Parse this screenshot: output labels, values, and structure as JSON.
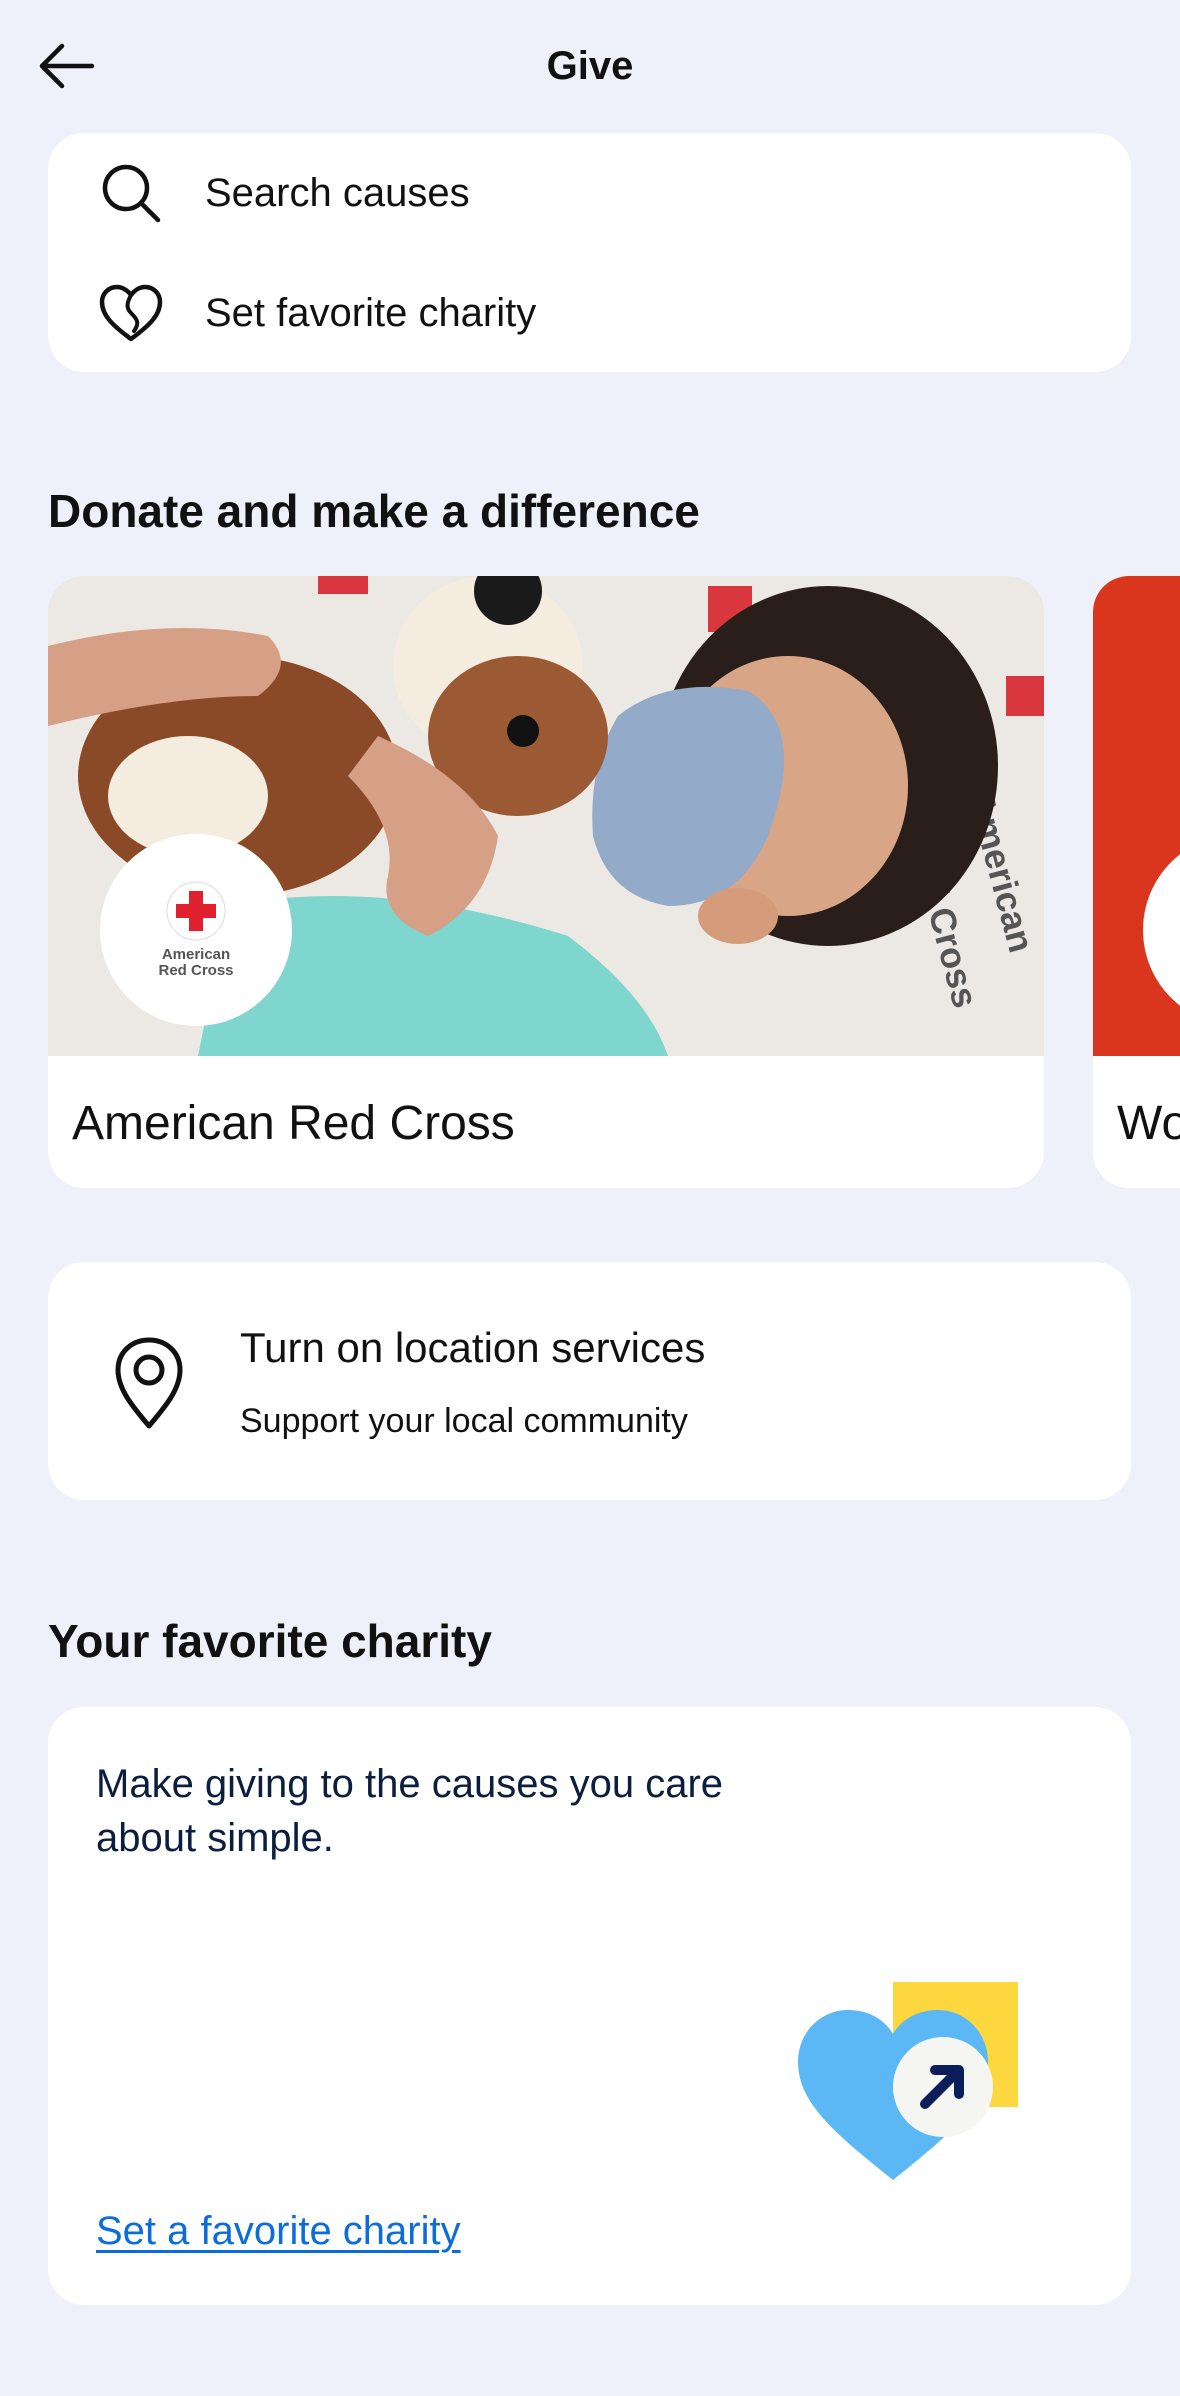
{
  "header": {
    "title": "Give"
  },
  "actions": {
    "search_label": "Search causes",
    "favorite_label": "Set favorite charity"
  },
  "donate_section": {
    "title": "Donate and make a difference",
    "cards": [
      {
        "name": "American Red Cross",
        "logo_text": "American Red Cross",
        "accent": "#e0202f"
      },
      {
        "name": "Wo",
        "accent": "#d9361d"
      }
    ]
  },
  "location": {
    "title": "Turn on location services",
    "subtitle": "Support your local community"
  },
  "favorite_section": {
    "title": "Your favorite charity",
    "description": "Make giving to the causes you care about simple.",
    "link_label": "Set a favorite charity"
  },
  "colors": {
    "background": "#eef1f9",
    "card": "#ffffff",
    "link": "#0a6ddb",
    "heart": "#5bb8f5",
    "yellow_tile": "#fcd73e"
  },
  "icons": [
    "back-arrow-icon",
    "search-icon",
    "heart-icon",
    "location-pin-icon",
    "arrow-up-right-icon"
  ]
}
